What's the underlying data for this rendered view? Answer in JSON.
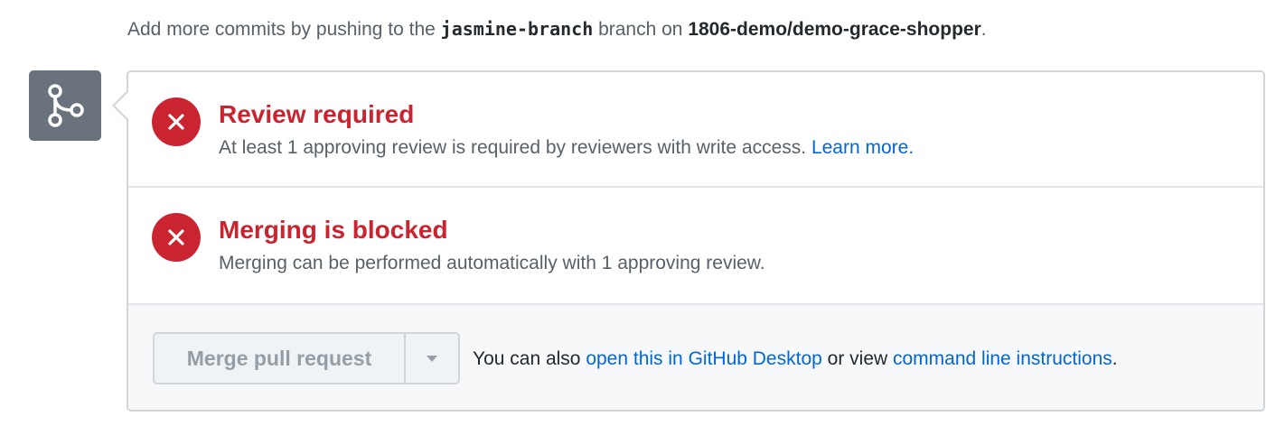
{
  "hint": {
    "prefix": "Add more commits by pushing to the ",
    "branch": "jasmine-branch",
    "middle": " branch on ",
    "repo": "1806-demo/demo-grace-shopper",
    "suffix": "."
  },
  "merge_icon": "git-merge-icon",
  "checks": [
    {
      "title": "Review required",
      "description": "At least 1 approving review is required by reviewers with write access.",
      "link_text": "Learn more.",
      "icon": "x-icon"
    },
    {
      "title": "Merging is blocked",
      "description": "Merging can be performed automatically with 1 approving review.",
      "icon": "x-icon"
    }
  ],
  "merge": {
    "button_label": "Merge pull request",
    "dropdown_icon": "triangle-down-icon",
    "also_text": "You can also ",
    "desktop_link": "open this in GitHub Desktop",
    "or_text": " or view ",
    "cli_link": "command line instructions",
    "end_text": "."
  },
  "colors": {
    "error_red": "#cb2431",
    "link_blue": "#0366d6",
    "icon_gray": "#6a737d"
  }
}
